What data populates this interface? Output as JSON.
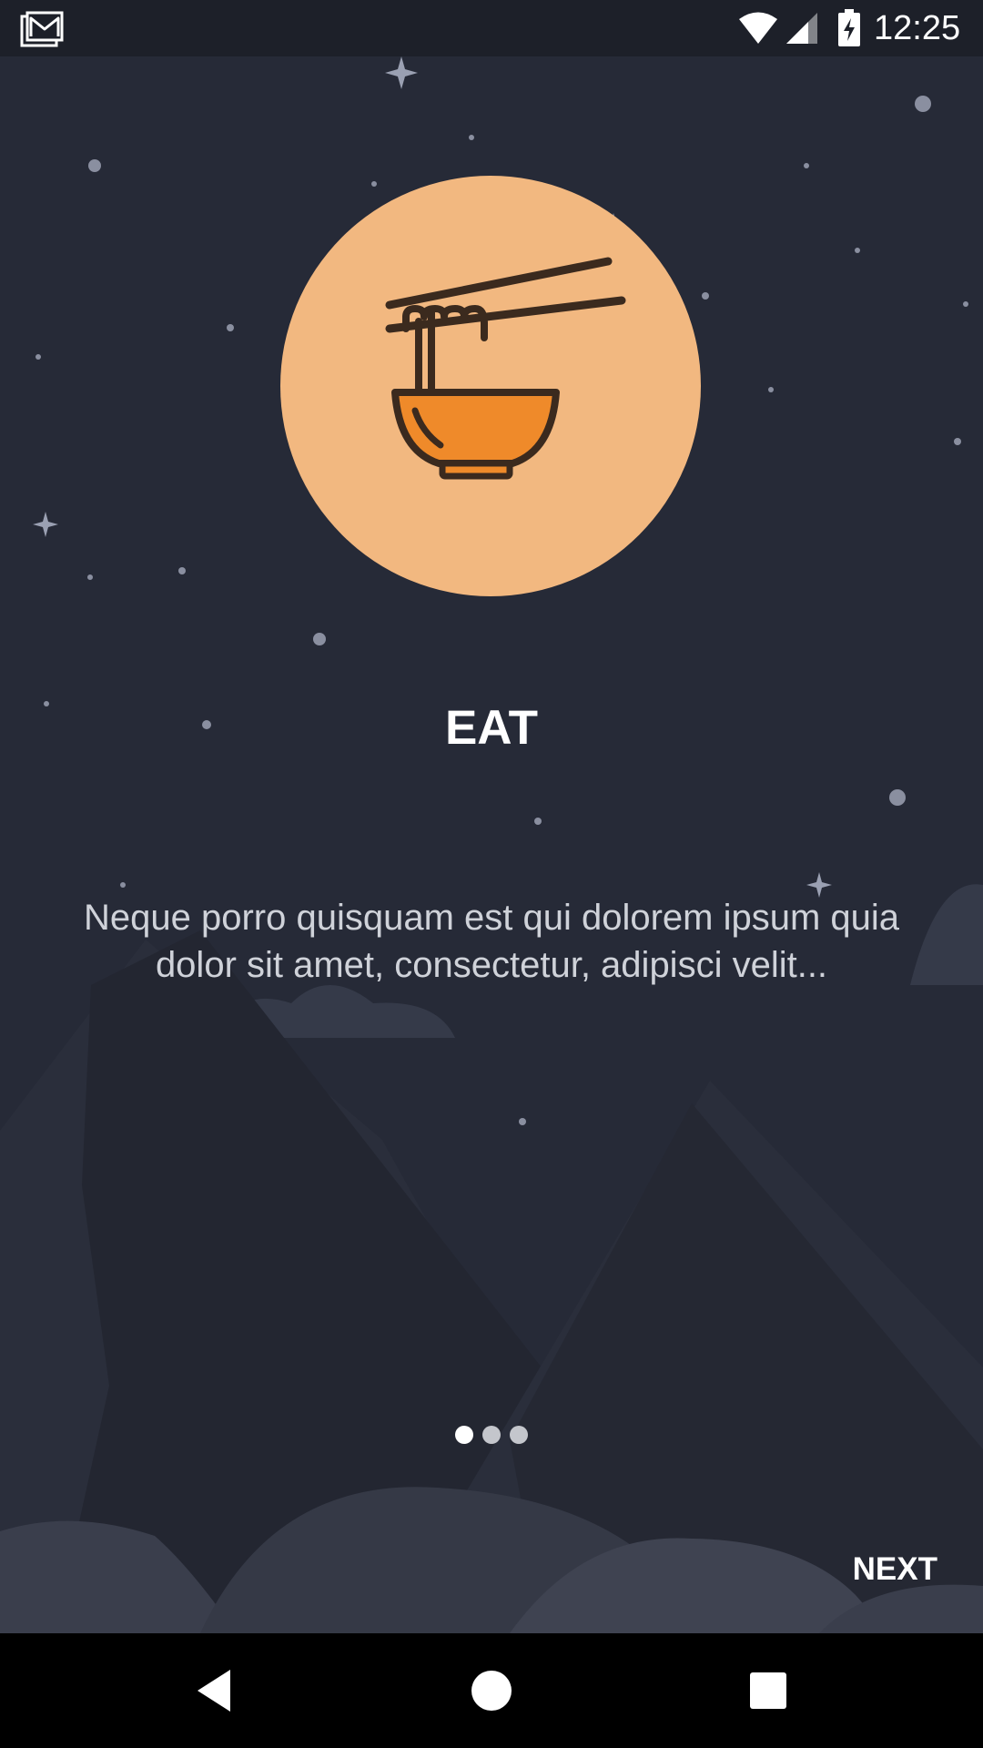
{
  "status_bar": {
    "time": "12:25",
    "icons": [
      "gmail-notification-icon",
      "wifi-icon",
      "cellular-signal-icon",
      "battery-charging-icon"
    ]
  },
  "onboarding": {
    "illustration_icon": "noodle-bowl-icon",
    "title": "EAT",
    "description": "Neque porro quisquam est qui dolorem ipsum quia dolor sit amet, consectetur, adipisci velit...",
    "page_indicator": {
      "total": 3,
      "current": 1
    },
    "next_label": "NEXT"
  },
  "colors": {
    "background": "#262a37",
    "status_bar": "#1d2029",
    "illustration_circle": "#f2b880",
    "bowl_fill": "#ef8a2a",
    "bowl_outline": "#3b2a1e"
  },
  "nav_bar": {
    "buttons": [
      "back-icon",
      "home-icon",
      "recents-icon"
    ]
  }
}
